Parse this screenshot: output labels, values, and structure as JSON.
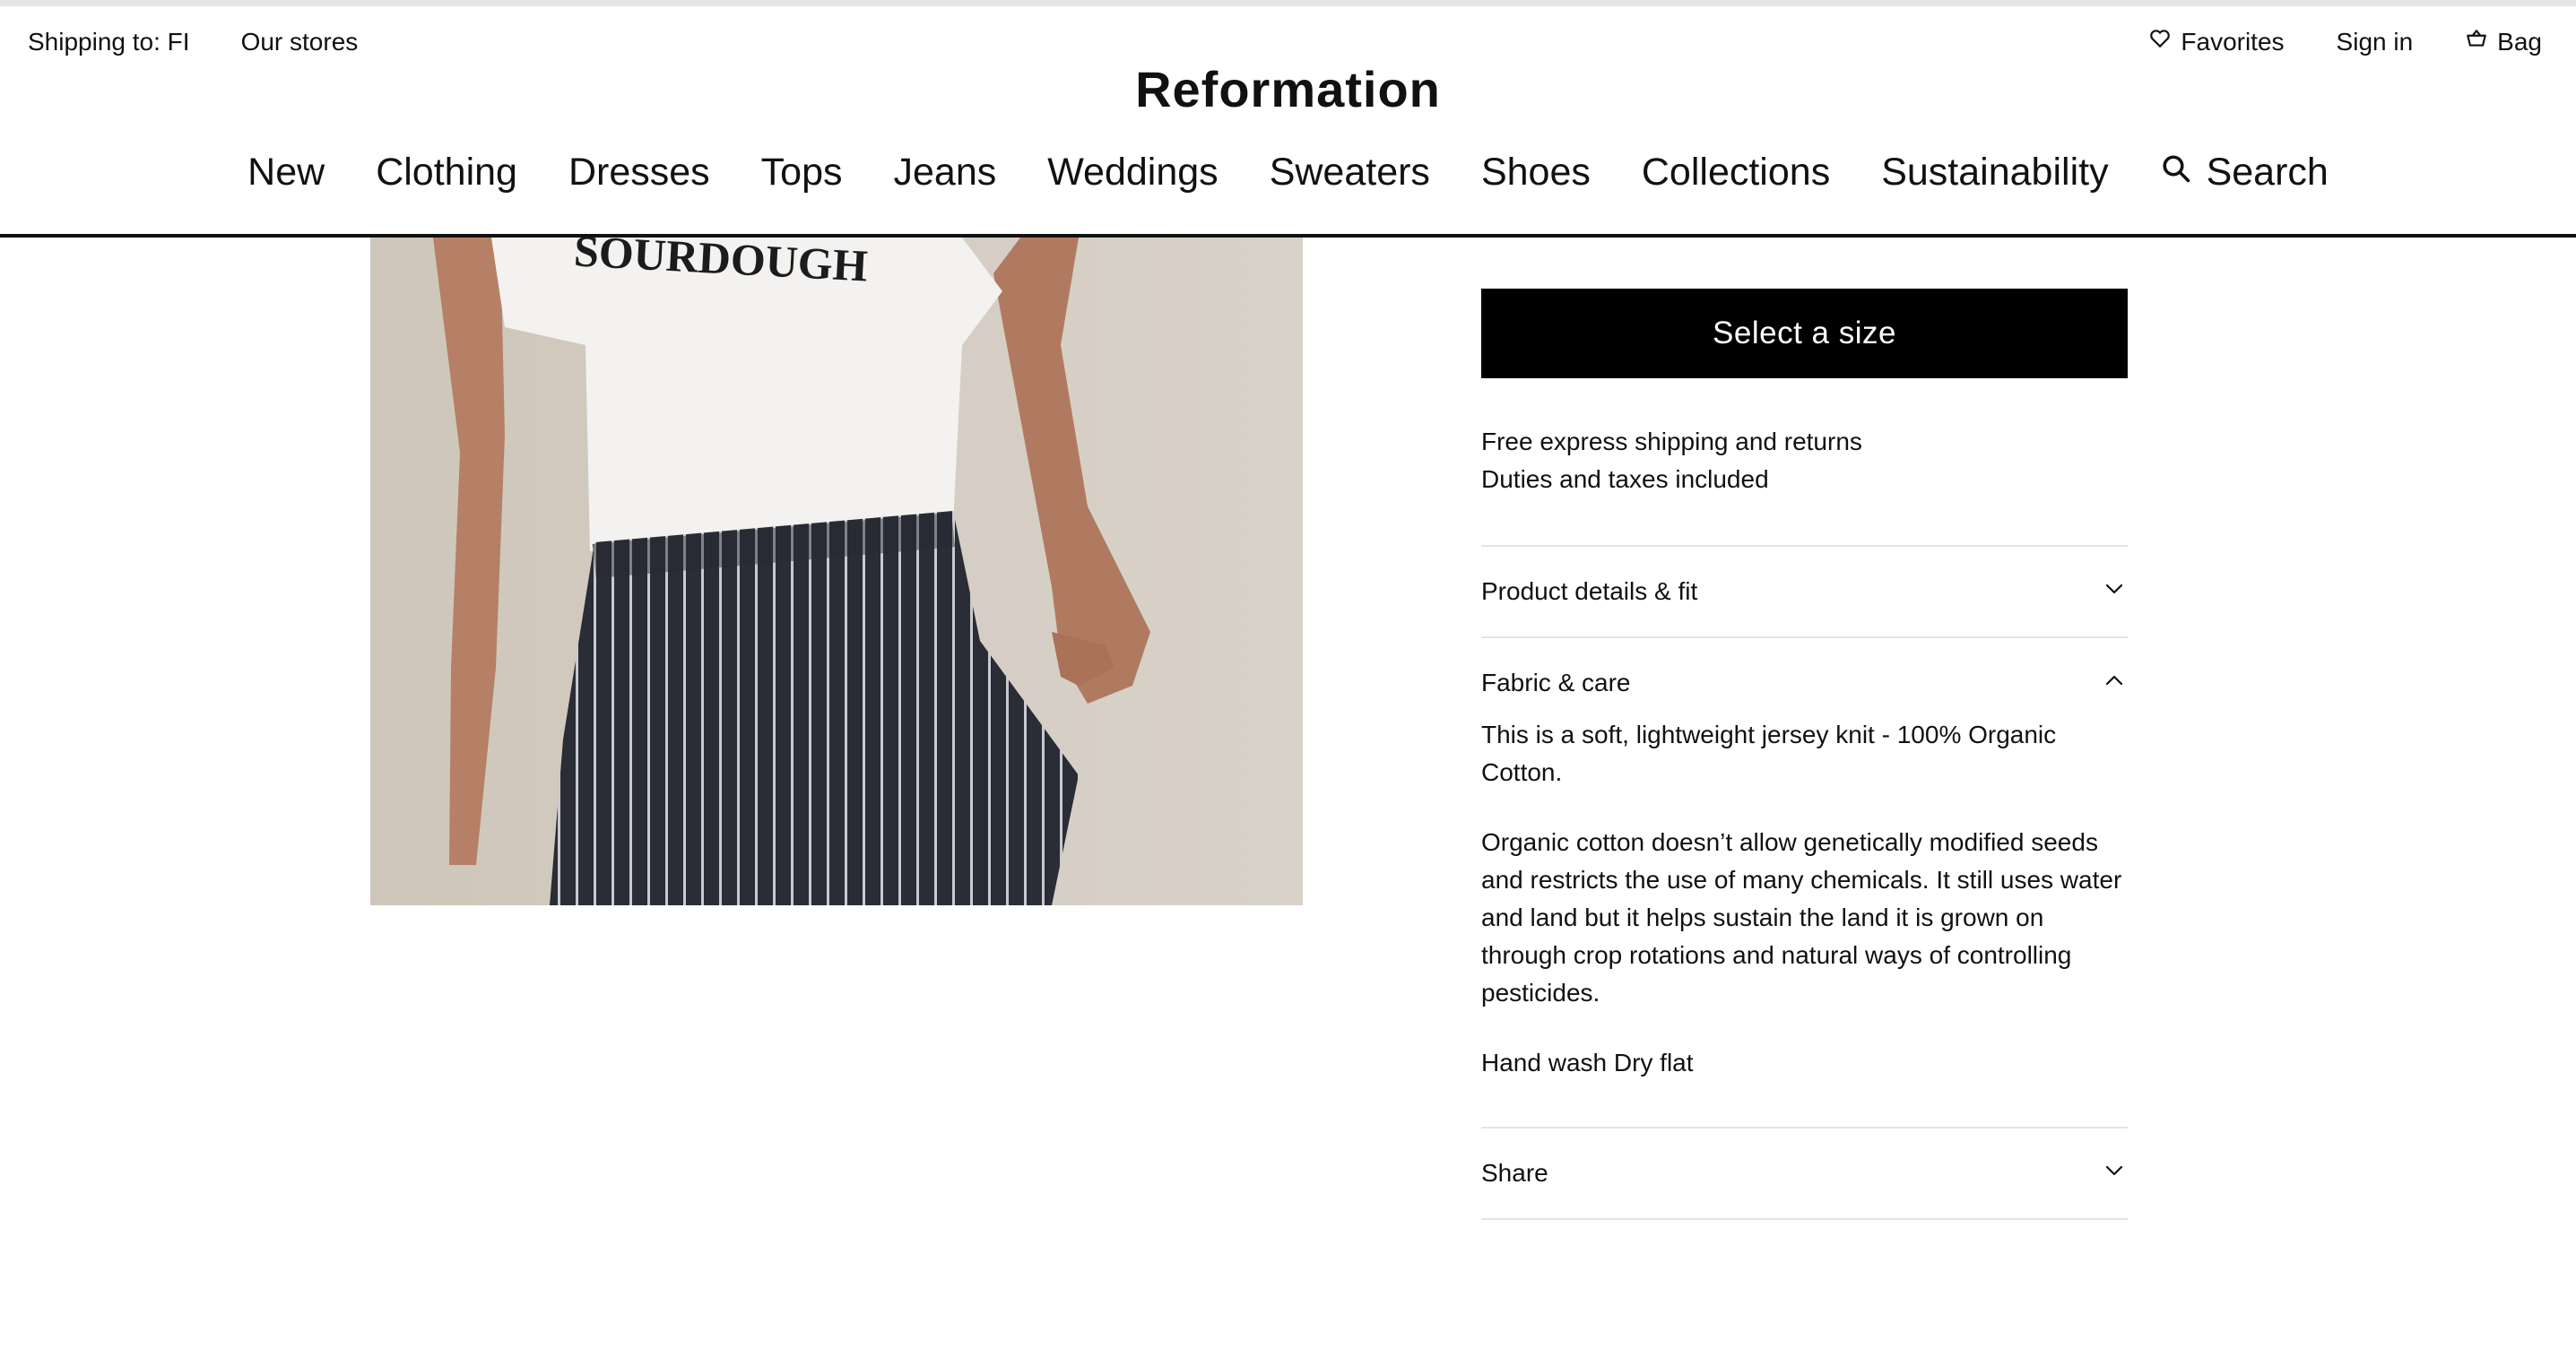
{
  "utility_bar": {
    "shipping": "Shipping to: FI",
    "stores": "Our stores",
    "favorites": "Favorites",
    "sign_in": "Sign in",
    "bag": "Bag"
  },
  "brand": "Reformation",
  "nav": {
    "items": [
      "New",
      "Clothing",
      "Dresses",
      "Tops",
      "Jeans",
      "Weddings",
      "Sweaters",
      "Shoes",
      "Collections",
      "Sustainability"
    ],
    "search": "Search"
  },
  "product_image": {
    "shirt_print": "SOURDOUGH"
  },
  "purchase": {
    "select_size": "Select a size",
    "shipping_line1": "Free express shipping and returns",
    "shipping_line2": "Duties and taxes included"
  },
  "accordions": {
    "details": {
      "title": "Product details & fit",
      "state": "collapsed"
    },
    "fabric": {
      "title": "Fabric & care",
      "state": "expanded",
      "paragraphs": [
        "This is a soft, lightweight jersey knit - 100% Organic Cotton.",
        "Organic cotton doesn’t allow genetically modified seeds and restricts the use of many chemicals. It still uses water and land but it helps sustain the land it is grown on through crop rotations and natural ways of controlling pesticides.",
        "Hand wash Dry flat"
      ]
    },
    "share": {
      "title": "Share",
      "state": "collapsed"
    }
  },
  "icons": {
    "favorites": "heart-icon",
    "bag": "basket-icon",
    "search": "search-icon",
    "collapsed": "chevron-down-icon",
    "expanded": "chevron-up-icon"
  },
  "colors": {
    "button_bg": "#000000",
    "button_text": "#ffffff",
    "divider": "#e4e4e4"
  }
}
